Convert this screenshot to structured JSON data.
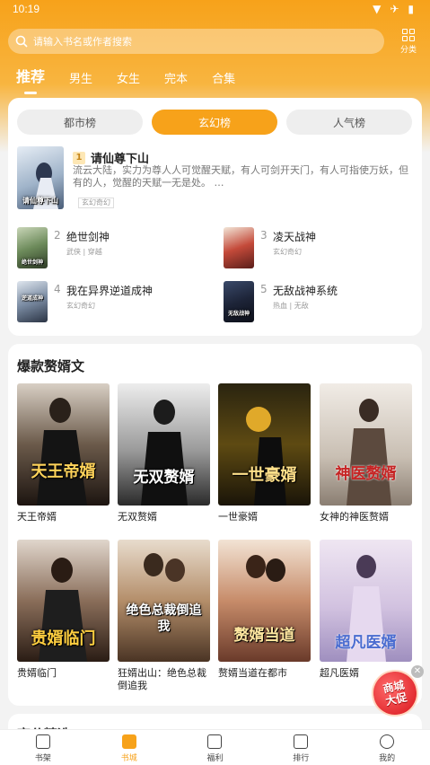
{
  "status_bar": {
    "time": "10:19"
  },
  "search": {
    "placeholder": "请输入书名或作者搜索"
  },
  "category_button": {
    "label": "分类"
  },
  "tabs": [
    {
      "label": "推荐",
      "active": true
    },
    {
      "label": "男生"
    },
    {
      "label": "女生"
    },
    {
      "label": "完本"
    },
    {
      "label": "合集"
    }
  ],
  "ranking": {
    "segments": [
      {
        "label": "都市榜"
      },
      {
        "label": "玄幻榜",
        "active": true
      },
      {
        "label": "人气榜"
      }
    ],
    "top": {
      "rank": "1",
      "title": "请仙尊下山",
      "description": "流云大陆，实力为尊人人可觉醒天赋，有人可剑开天门，有人可指使万妖，但有的人，觉醒的天赋一无是处。 …",
      "tag": "玄幻奇幻",
      "cover_text": "请仙尊下山"
    },
    "items": [
      {
        "rank": "2",
        "title": "绝世剑神",
        "meta": "武侠 | 穿越",
        "cover_text": "绝世剑神"
      },
      {
        "rank": "3",
        "title": "凌天战神",
        "meta": "玄幻奇幻",
        "cover_text": ""
      },
      {
        "rank": "4",
        "title": "我在异界逆道成神",
        "meta": "玄幻奇幻",
        "cover_text": "逆道成神"
      },
      {
        "rank": "5",
        "title": "无敌战神系统",
        "meta": "热血 | 无敌",
        "cover_text": "无敌战神"
      }
    ]
  },
  "section": {
    "title": "爆款赘婿文",
    "books": [
      {
        "name": "天王帝婿",
        "cover_text": "天王帝婿"
      },
      {
        "name": "无双赘婿",
        "cover_text": "无双赘婿"
      },
      {
        "name": "一世豪婿",
        "cover_text": "一世豪婿"
      },
      {
        "name": "女神的神医赘婿",
        "cover_text": "神医赘婿"
      },
      {
        "name": "贵婿临门",
        "cover_text": "贵婿临门"
      },
      {
        "name": "狂婿出山：绝色总裁倒追我",
        "cover_text": "绝色总裁倒追我"
      },
      {
        "name": "赘婿当道在都市",
        "cover_text": "赘婿当道"
      },
      {
        "name": "超凡医婿",
        "cover_text": "超凡医婿"
      }
    ]
  },
  "next_section": {
    "title": "高分精选"
  },
  "promo": {
    "line1": "商城",
    "line2": "大促"
  },
  "bottom_nav": [
    {
      "label": "书架"
    },
    {
      "label": "书城",
      "active": true
    },
    {
      "label": "福利"
    },
    {
      "label": "排行"
    },
    {
      "label": "我的"
    }
  ],
  "colors": {
    "accent": "#f7a21a",
    "background": "#f3f3f3"
  }
}
